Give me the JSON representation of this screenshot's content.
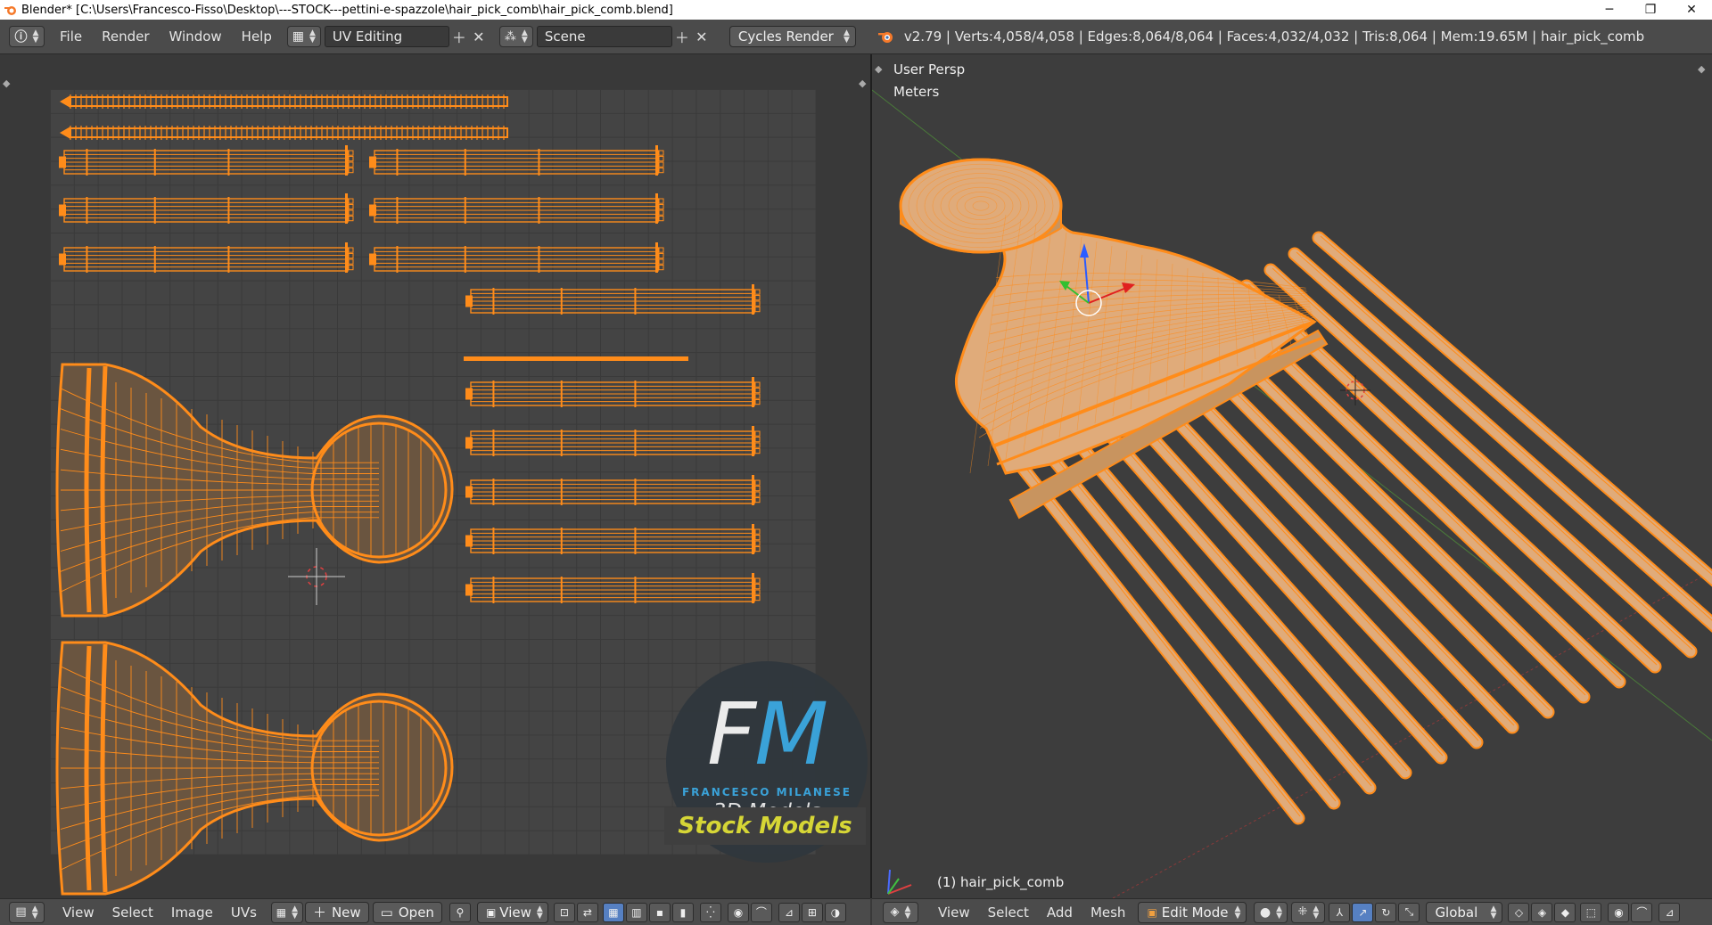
{
  "window": {
    "title": "Blender* [C:\\Users\\Francesco-Fisso\\Desktop\\---STOCK---pettini-e-spazzole\\hair_pick_comb\\hair_pick_comb.blend]",
    "minimize": "─",
    "maximize": "❐",
    "close": "✕"
  },
  "topbar": {
    "menus": [
      "File",
      "Render",
      "Window",
      "Help"
    ],
    "layout": "UV Editing",
    "scene": "Scene",
    "render_engine": "Cycles Render",
    "stats": "v2.79 | Verts:4,058/4,058 | Edges:8,064/8,064 | Faces:4,032/4,032 | Tris:8,064 | Mem:19.65M | hair_pick_comb"
  },
  "viewport": {
    "view_name": "User Persp",
    "units": "Meters",
    "object_label": "(1) hair_pick_comb"
  },
  "uv_bottombar": {
    "menus": [
      "View",
      "Select",
      "Image",
      "UVs"
    ],
    "new_label": "New",
    "open_label": "Open",
    "view_label": "View"
  },
  "vp_bottombar": {
    "menus": [
      "View",
      "Select",
      "Add",
      "Mesh"
    ],
    "mode": "Edit Mode",
    "orientation": "Global"
  },
  "watermark": {
    "letters": "FM",
    "subtitle": "FRANCESCO MILANESE",
    "tagline": "3D Models",
    "stock": "Stock Models"
  },
  "colors": {
    "uv_orange": "#ff8c1a",
    "mesh_fill": "#e0ab7a",
    "accent_blue": "#3aa6df",
    "stock_yellow": "#d6d636"
  },
  "icons": [
    "info-icon",
    "layout-icon",
    "scene-icon",
    "blender-logo-icon",
    "editor-type-icon",
    "image-icon",
    "pin-icon",
    "cube-icon",
    "sphere-icon",
    "manipulator-icon",
    "snap-icon"
  ]
}
